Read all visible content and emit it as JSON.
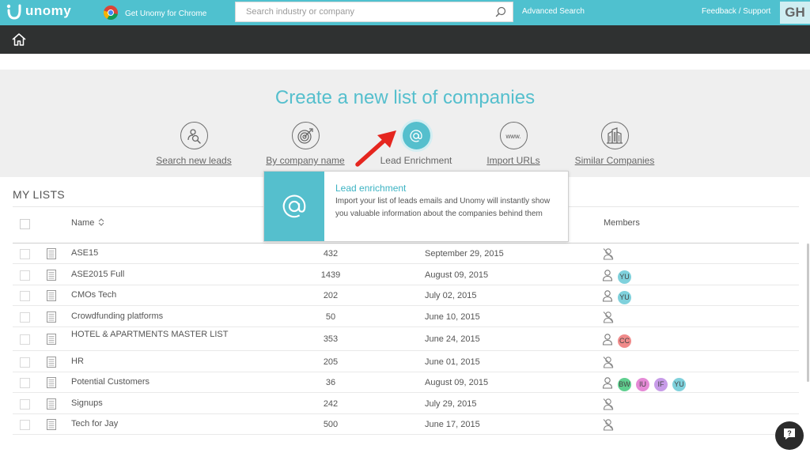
{
  "topbar": {
    "brand": "unomy",
    "chrome_link": "Get Unomy for Chrome",
    "search_placeholder": "Search industry or company",
    "advanced_search": "Advanced Search",
    "feedback": "Feedback / Support",
    "user_initials": "GH"
  },
  "create": {
    "title": "Create a new list of companies",
    "options": [
      {
        "label": "Search new leads",
        "icon": "search-leads-icon"
      },
      {
        "label": "By company name",
        "icon": "target-icon"
      },
      {
        "label": "Lead Enrichment",
        "icon": "at-icon"
      },
      {
        "label": "Import URLs",
        "icon": "www-icon"
      },
      {
        "label": "Similar Companies",
        "icon": "buildings-icon"
      }
    ],
    "active_option": "Lead Enrichment"
  },
  "popover": {
    "title": "Lead enrichment",
    "description": "Import your list of leads emails and Unomy will instantly show you valuable information about the companies behind them"
  },
  "lists": {
    "title": "MY LISTS",
    "columns": {
      "name": "Name",
      "members": "Members"
    },
    "rows": [
      {
        "name": "ASE15",
        "count": "432",
        "date": "September 29, 2015",
        "members": []
      },
      {
        "name": "ASE2015 Full",
        "count": "1439",
        "date": "August 09, 2015",
        "members": [
          "YU"
        ]
      },
      {
        "name": "CMOs Tech",
        "count": "202",
        "date": "July 02, 2015",
        "members": [
          "YU"
        ]
      },
      {
        "name": "Crowdfunding platforms",
        "count": "50",
        "date": "June 10, 2015",
        "members": []
      },
      {
        "name": "HOTEL & APARTMENTS MASTER LIST",
        "count": "353",
        "date": "June 24, 2015",
        "members": [
          "CC"
        ]
      },
      {
        "name": "HR",
        "count": "205",
        "date": "June 01, 2015",
        "members": []
      },
      {
        "name": "Potential Customers",
        "count": "36",
        "date": "August 09, 2015",
        "members": [
          "BW",
          "IU",
          "IF",
          "YU"
        ]
      },
      {
        "name": "Signups",
        "count": "242",
        "date": "July 29, 2015",
        "members": []
      },
      {
        "name": "Tech for Jay",
        "count": "500",
        "date": "June 17, 2015",
        "members": []
      }
    ]
  },
  "colors": {
    "accent": "#55bfcd",
    "topbar": "#4fc1cf",
    "darkbar": "#2f3131",
    "annotation_arrow": "#e5261f",
    "badge_YU": "#7fd1dc",
    "badge_CC": "#f08a8a",
    "badge_BW": "#5fcf8f",
    "badge_IU": "#e58ad6",
    "badge_IF": "#c79be8"
  }
}
